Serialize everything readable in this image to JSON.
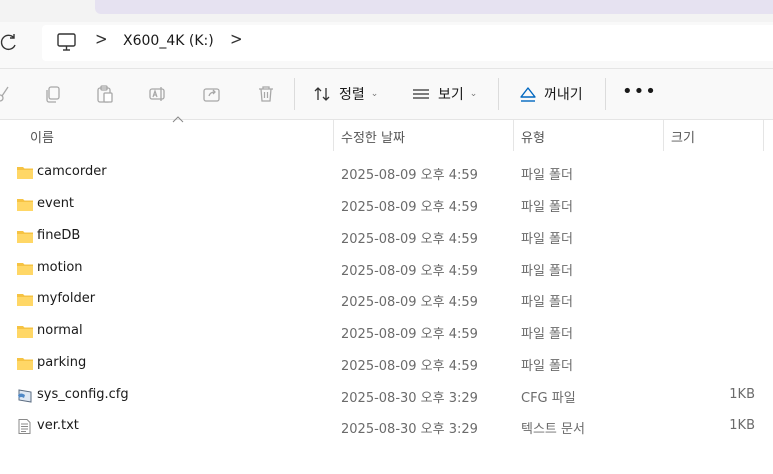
{
  "address": {
    "breadcrumb_label": "X600_4K (K:)",
    "separator": ">"
  },
  "toolbar": {
    "sort_label": "정렬",
    "view_label": "보기",
    "eject_label": "꺼내기",
    "more_label": "•••"
  },
  "columns": {
    "name": "이름",
    "modified": "수정한 날짜",
    "type": "유형",
    "size": "크기"
  },
  "files": [
    {
      "name": "camcorder",
      "modified": "2025-08-09 오후 4:59",
      "type": "파일 폴더",
      "size": "",
      "icon": "folder-icon"
    },
    {
      "name": "event",
      "modified": "2025-08-09 오후 4:59",
      "type": "파일 폴더",
      "size": "",
      "icon": "folder-icon"
    },
    {
      "name": "fineDB",
      "modified": "2025-08-09 오후 4:59",
      "type": "파일 폴더",
      "size": "",
      "icon": "folder-icon"
    },
    {
      "name": "motion",
      "modified": "2025-08-09 오후 4:59",
      "type": "파일 폴더",
      "size": "",
      "icon": "folder-icon"
    },
    {
      "name": "myfolder",
      "modified": "2025-08-09 오후 4:59",
      "type": "파일 폴더",
      "size": "",
      "icon": "folder-icon"
    },
    {
      "name": "normal",
      "modified": "2025-08-09 오후 4:59",
      "type": "파일 폴더",
      "size": "",
      "icon": "folder-icon"
    },
    {
      "name": "parking",
      "modified": "2025-08-09 오후 4:59",
      "type": "파일 폴더",
      "size": "",
      "icon": "folder-icon"
    },
    {
      "name": "sys_config.cfg",
      "modified": "2025-08-30 오후 3:29",
      "type": "CFG 파일",
      "size": "1KB",
      "icon": "config-file-icon"
    },
    {
      "name": "ver.txt",
      "modified": "2025-08-30 오후 3:29",
      "type": "텍스트 문서",
      "size": "1KB",
      "icon": "text-file-icon"
    }
  ],
  "colors": {
    "folder": "#f6c343",
    "accent": "#0067c0",
    "address_tab": "#e6e2f1"
  }
}
